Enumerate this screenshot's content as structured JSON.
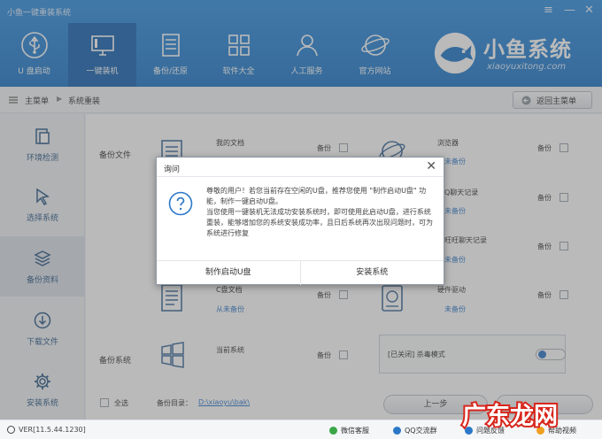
{
  "window": {
    "title": "小鱼一键重装系统",
    "menu_glyph": "≡",
    "minimize_glyph": "—",
    "close_glyph": "✕"
  },
  "nav": {
    "items": [
      {
        "label": "U 盘启动",
        "icon": "usb-icon"
      },
      {
        "label": "一键装机",
        "icon": "monitor-icon",
        "active": true
      },
      {
        "label": "备份/还原",
        "icon": "document-icon"
      },
      {
        "label": "软件大全",
        "icon": "grid-icon"
      },
      {
        "label": "人工服务",
        "icon": "person-icon"
      },
      {
        "label": "官方网站",
        "icon": "globe-icon"
      }
    ]
  },
  "logo": {
    "text": "小鱼系统",
    "url": "xiaoyuxitong.com"
  },
  "breadcrumb": {
    "home": "主菜单",
    "separator": "▶",
    "current": "系统重装"
  },
  "back_button": {
    "label": "返回主菜单"
  },
  "sidebar": {
    "items": [
      {
        "label": "环境检测",
        "icon": "clipboard-icon"
      },
      {
        "label": "选择系统",
        "icon": "cursor-icon"
      },
      {
        "label": "备份资料",
        "icon": "layers-icon",
        "active": true
      },
      {
        "label": "下载文件",
        "icon": "download-icon"
      },
      {
        "label": "安装系统",
        "icon": "gear-icon"
      }
    ]
  },
  "backup": {
    "files_label": "备份文件",
    "system_label": "备份系统",
    "checkbox_label": "备份",
    "items": {
      "my_docs": {
        "name": "我的文档"
      },
      "browser": {
        "name": "浏览器",
        "status": "未备份"
      },
      "qq_chat": {
        "name": "Q聊天记录",
        "status": "未备份"
      },
      "wangwang": {
        "name": "旺旺聊天记录",
        "status": "未备份"
      },
      "c_docs": {
        "name": "C盘文档",
        "status": "从未备份"
      },
      "hw_driver": {
        "name": "硬件驱动",
        "status": "未备份"
      },
      "current_sys": {
        "name": "当前系统"
      }
    },
    "kill_mode": "[已关闭] 杀毒模式",
    "kill_mode_on": false,
    "select_all": "全选",
    "dir_label": "备份目录：",
    "dir_path": "D:\\xiaoyu\\bak\\",
    "prev_button": "上一步"
  },
  "footer": {
    "version": "VER[11.5.44.1230]",
    "links": [
      {
        "label": "微信客服",
        "color": "#3aa648"
      },
      {
        "label": "QQ交流群",
        "color": "#2b78c9"
      },
      {
        "label": "问题反馈",
        "color": "#2b78c9"
      },
      {
        "label": "帮助视频",
        "color": "#f0a020"
      }
    ]
  },
  "dialog": {
    "title": "询问",
    "close_glyph": "✕",
    "message_1": "尊敬的用户！若您当前存在空闲的U盘，推荐您使用 \"制作启动U盘\" 功能，制作一键启动U盘。",
    "message_2": "当您使用一键装机无法成功安装系统时，即可使用此启动U盘，进行系统重装，能够增加您的系统安装成功率，且日后系统再次出现问题时，可为系统进行修复",
    "button_make": "制作启动U盘",
    "button_install": "安装系统"
  },
  "watermark": {
    "text": "广东龙网"
  },
  "colors": {
    "header": "#1d76c9",
    "accent": "#2b78c9",
    "watermark": "#d8261c"
  }
}
